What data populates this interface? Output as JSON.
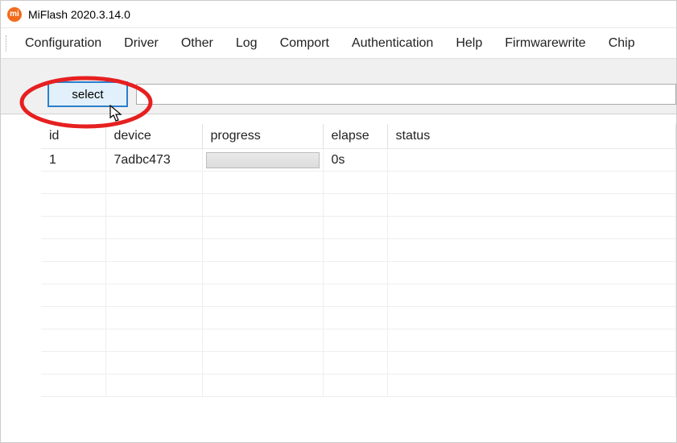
{
  "window": {
    "title": "MiFlash 2020.3.14.0",
    "icon_label": "mi"
  },
  "menubar": {
    "items": [
      "Configuration",
      "Driver",
      "Other",
      "Log",
      "Comport",
      "Authentication",
      "Help",
      "Firmwarewrite",
      "Chip"
    ]
  },
  "toolbar": {
    "select_label": "select",
    "path_value": ""
  },
  "table": {
    "headers": {
      "id": "id",
      "device": "device",
      "progress": "progress",
      "elapse": "elapse",
      "status": "status"
    },
    "rows": [
      {
        "id": "1",
        "device": "7adbc473",
        "elapse": "0s",
        "status": ""
      }
    ]
  }
}
